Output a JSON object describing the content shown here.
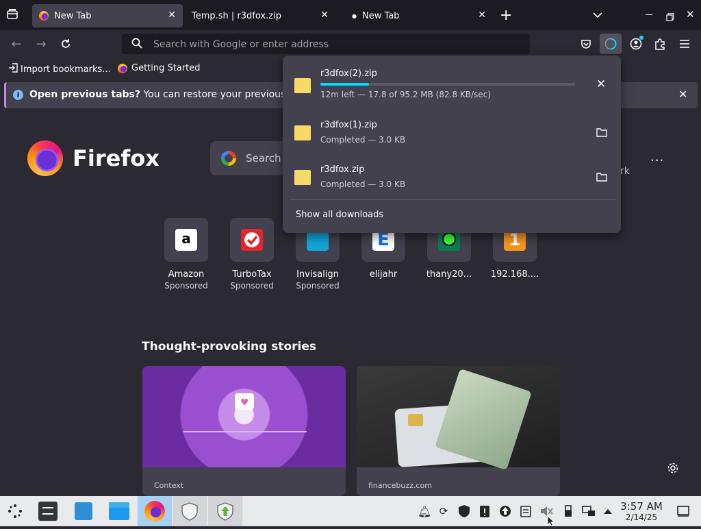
{
  "tabs": [
    {
      "label": "New Tab",
      "active": true
    },
    {
      "label": "Temp.sh | r3dfox.zip",
      "active": false
    },
    {
      "label": "New Tab",
      "active": false
    }
  ],
  "urlbar": {
    "placeholder": "Search with Google or enter address"
  },
  "bookmarks": [
    {
      "label": "Import bookmarks...",
      "icon": "import-icon"
    },
    {
      "label": "Getting Started",
      "icon": "firefox-icon"
    }
  ],
  "notification": {
    "bold": "Open previous tabs?",
    "text": " You can restore your previous session"
  },
  "home": {
    "brand": "Firefox",
    "search_placeholder": "Search",
    "partial_text": "rk",
    "top_sites": [
      {
        "label": "Amazon",
        "sub": "Sponsored",
        "icon": "amazon-icon"
      },
      {
        "label": "TurboTax",
        "sub": "Sponsored",
        "icon": "turbotax-icon"
      },
      {
        "label": "Invisalign",
        "sub": "Sponsored",
        "icon": "invisalign-icon"
      },
      {
        "label": "elijahr",
        "sub": "",
        "icon": "elijahr-icon"
      },
      {
        "label": "thany20...",
        "sub": "",
        "icon": "thany-icon"
      },
      {
        "label": "192.168....",
        "sub": "",
        "icon": "local-site-icon"
      }
    ],
    "stories_heading": "Thought-provoking stories",
    "stories": [
      {
        "source": "Context"
      },
      {
        "source": "financebuzz.com"
      }
    ]
  },
  "downloads": {
    "items": [
      {
        "name": "r3dfox(2).zip",
        "status": "12m left — 17.8 of 95.2 MB (82.8 KB/sec)",
        "progress": 0.19,
        "in_progress": true
      },
      {
        "name": "r3dfox(1).zip",
        "status": "Completed — 3.0 KB",
        "in_progress": false
      },
      {
        "name": "r3dfox.zip",
        "status": "Completed — 3.0 KB",
        "in_progress": false
      }
    ],
    "show_all": "Show all downloads"
  },
  "clock": {
    "time": "3:57 AM",
    "date": "2/14/25"
  },
  "colors": {
    "accent": "#00ddff",
    "toolbar": "#2b2a33",
    "tabstrip": "#1c1b22",
    "panel": "#42414d"
  }
}
